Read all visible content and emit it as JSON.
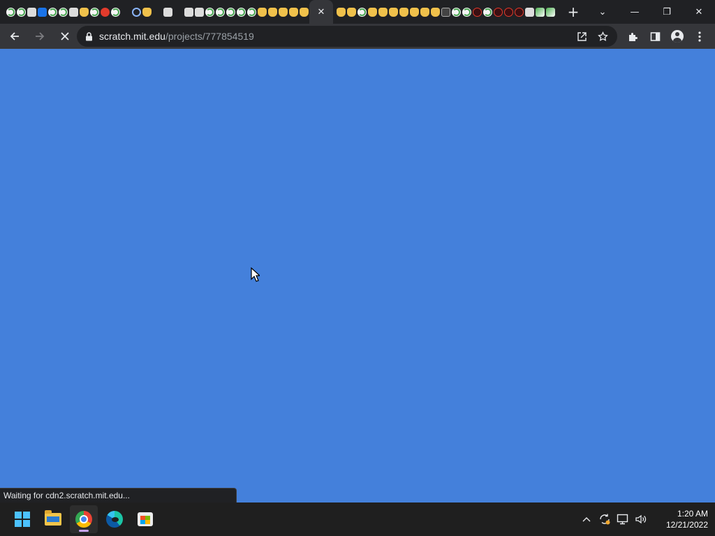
{
  "browser": {
    "tab_favicons": [
      "scratch",
      "scratch",
      "white",
      "blue",
      "scratch",
      "scratch",
      "white",
      "orange",
      "scratch",
      "red",
      "scratch",
      "bracket",
      "ring",
      "orange",
      "bracket",
      "white",
      "bracket",
      "white",
      "white",
      "scratch",
      "scratch",
      "scratch",
      "scratch",
      "scratch",
      "orange",
      "orange",
      "orange",
      "orange",
      "orange"
    ],
    "tab_favicons_after_active": [
      "orange",
      "orange",
      "scratch",
      "orange",
      "orange",
      "orange",
      "orange",
      "orange",
      "orange",
      "orange",
      "dark",
      "scratch",
      "scratch",
      "darkred",
      "scratch",
      "darkred",
      "darkred",
      "darkred",
      "white",
      "gradient",
      "gradient"
    ],
    "active_tab_close": "✕",
    "new_tab": "+",
    "window_controls": {
      "tab_search": "⌄",
      "minimize": "—",
      "restore": "❐",
      "close": "✕"
    },
    "url_host": "scratch.mit.edu",
    "url_path": "/projects/777854519"
  },
  "status_text": "Waiting for cdn2.scratch.mit.edu...",
  "taskbar": {
    "time": "1:20 AM",
    "date": "12/21/2022"
  },
  "colors": {
    "page_background": "#4480db",
    "browser_frame": "#202124",
    "toolbar": "#35363a"
  }
}
